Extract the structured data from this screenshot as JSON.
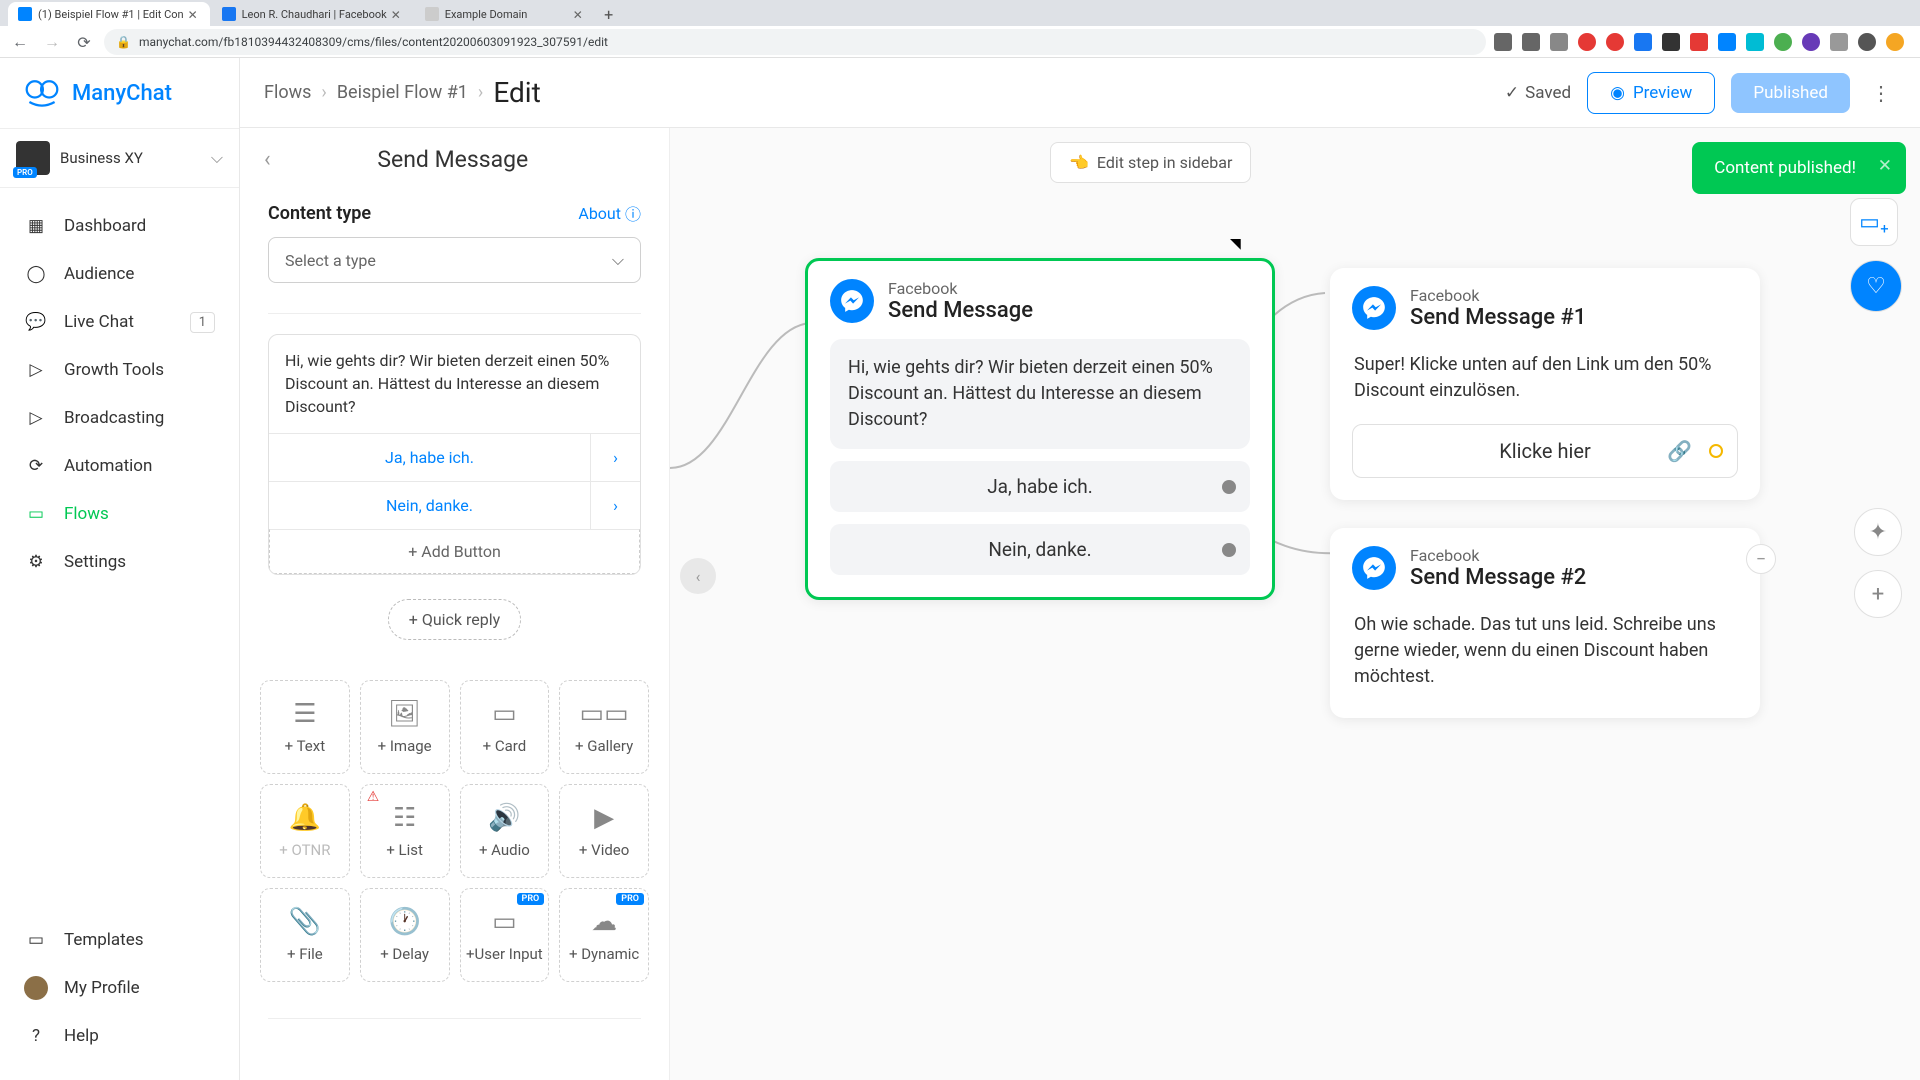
{
  "browser": {
    "tabs": [
      {
        "title": "(1) Beispiel Flow #1 | Edit Con"
      },
      {
        "title": "Leon R. Chaudhari | Facebook"
      },
      {
        "title": "Example Domain"
      }
    ],
    "url": "manychat.com/fb181039443240830​9/cms/files/content20200603091923_307591/edit"
  },
  "brand": {
    "name": "ManyChat"
  },
  "workspace": {
    "name": "Business XY",
    "badge": "PRO"
  },
  "nav": {
    "items": [
      {
        "label": "Dashboard"
      },
      {
        "label": "Audience"
      },
      {
        "label": "Live Chat",
        "badge": "1"
      },
      {
        "label": "Growth Tools"
      },
      {
        "label": "Broadcasting"
      },
      {
        "label": "Automation"
      },
      {
        "label": "Flows"
      },
      {
        "label": "Settings"
      }
    ],
    "bottom": [
      {
        "label": "Templates"
      },
      {
        "label": "My Profile"
      },
      {
        "label": "Help"
      }
    ]
  },
  "topbar": {
    "crumb1": "Flows",
    "crumb2": "Beispiel Flow #1",
    "current": "Edit",
    "saved": "Saved",
    "preview": "Preview",
    "published": "Published"
  },
  "toast": {
    "text": "Content published!"
  },
  "hint": {
    "text": "Edit step in sidebar"
  },
  "panel": {
    "title": "Send Message",
    "content_type_label": "Content type",
    "about": "About",
    "select_placeholder": "Select a type",
    "message": "Hi, wie gehts dir? Wir bieten derzeit einen 50% Discount an. Hättest du Interesse an diesem Discount?",
    "btn1": "Ja, habe ich.",
    "btn2": "Nein, danke.",
    "add_button": "+ Add Button",
    "quick_reply": "+ Quick reply",
    "blocks": [
      "+ Text",
      "+ Image",
      "+ Card",
      "+ Gallery",
      "+ OTNR",
      "+ List",
      "+ Audio",
      "+ Video",
      "+ File",
      "+ Delay",
      "+User Input",
      "+ Dynamic"
    ]
  },
  "nodes": {
    "main": {
      "platform": "Facebook",
      "title": "Send Message",
      "text": "Hi, wie gehts dir? Wir bieten derzeit einen 50% Discount an. Hättest du Interesse an diesem Discount?",
      "btn1": "Ja, habe ich.",
      "btn2": "Nein, danke."
    },
    "n1": {
      "platform": "Facebook",
      "title": "Send Message #1",
      "text": "Super! Klicke unten auf den Link um den 50% Discount einzulösen.",
      "link": "Klicke hier"
    },
    "n2": {
      "platform": "Facebook",
      "title": "Send Message #2",
      "text": "Oh wie schade. Das tut uns leid. Schreibe uns gerne wieder, wenn du einen Discount haben möchtest."
    }
  }
}
